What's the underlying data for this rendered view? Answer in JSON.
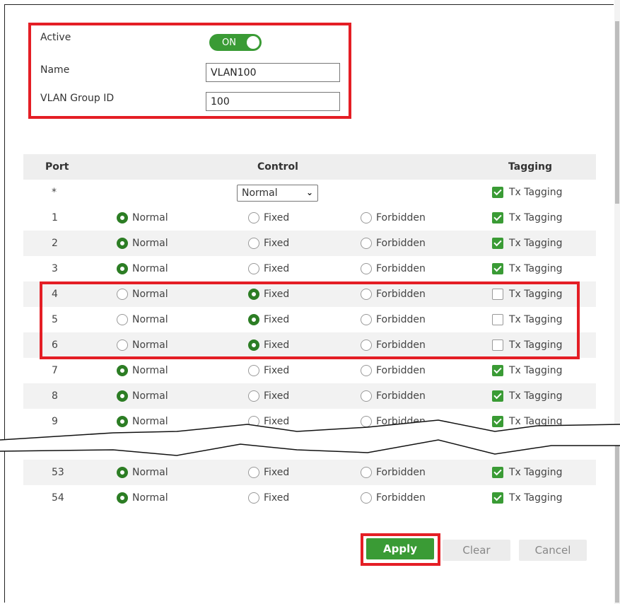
{
  "form": {
    "active_label": "Active",
    "active_toggle": "ON",
    "name_label": "Name",
    "name_value": "VLAN100",
    "group_label": "VLAN Group ID",
    "group_value": "100"
  },
  "table": {
    "headers": {
      "port": "Port",
      "control": "Control",
      "tagging": "Tagging"
    },
    "all_row": {
      "port": "*",
      "control_select": "Normal",
      "tagging": "Tx Tagging"
    },
    "rows": [
      {
        "port": "1",
        "normal": "Normal",
        "fixed": "Fixed",
        "forbidden": "Forbidden",
        "tagging": "Tx Tagging"
      },
      {
        "port": "2",
        "normal": "Normal",
        "fixed": "Fixed",
        "forbidden": "Forbidden",
        "tagging": "Tx Tagging"
      },
      {
        "port": "3",
        "normal": "Normal",
        "fixed": "Fixed",
        "forbidden": "Forbidden",
        "tagging": "Tx Tagging"
      },
      {
        "port": "4",
        "normal": "Normal",
        "fixed": "Fixed",
        "forbidden": "Forbidden",
        "tagging": "Tx Tagging"
      },
      {
        "port": "5",
        "normal": "Normal",
        "fixed": "Fixed",
        "forbidden": "Forbidden",
        "tagging": "Tx Tagging"
      },
      {
        "port": "6",
        "normal": "Normal",
        "fixed": "Fixed",
        "forbidden": "Forbidden",
        "tagging": "Tx Tagging"
      },
      {
        "port": "7",
        "normal": "Normal",
        "fixed": "Fixed",
        "forbidden": "Forbidden",
        "tagging": "Tx Tagging"
      },
      {
        "port": "8",
        "normal": "Normal",
        "fixed": "Fixed",
        "forbidden": "Forbidden",
        "tagging": "Tx Tagging"
      },
      {
        "port": "9",
        "normal": "Normal",
        "fixed": "Fixed",
        "forbidden": "Forbidden",
        "tagging": "Tx Tagging"
      },
      {
        "port": "53",
        "normal": "Normal",
        "fixed": "Fixed",
        "forbidden": "Forbidden",
        "tagging": "Tx Tagging"
      },
      {
        "port": "54",
        "normal": "Normal",
        "fixed": "Fixed",
        "forbidden": "Forbidden",
        "tagging": "Tx Tagging"
      }
    ]
  },
  "buttons": {
    "apply": "Apply",
    "clear": "Clear",
    "cancel": "Cancel"
  },
  "colors": {
    "accent_green": "#3a9b35",
    "highlight_red": "#e41e25"
  }
}
